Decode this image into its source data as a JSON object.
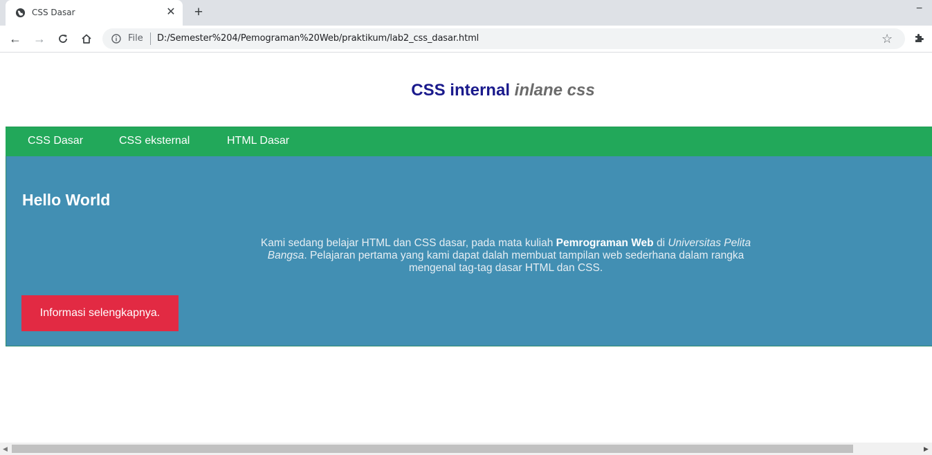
{
  "browser": {
    "tab": {
      "title": "CSS Dasar",
      "favicon": "globe-icon",
      "close_glyph": "✕"
    },
    "new_tab_glyph": "+",
    "minimize_glyph": "−",
    "toolbar": {
      "back_glyph": "←",
      "forward_glyph": "→",
      "reload_glyph": "C",
      "home_glyph": "⌂",
      "url_scheme": "File",
      "url": "D:/Semester%204/Pemograman%20Web/praktikum/lab2_css_dasar.html",
      "star_glyph": "☆"
    }
  },
  "page": {
    "title_main": "CSS internal",
    "title_italic": "inlane css",
    "nav": [
      {
        "label": "CSS Dasar"
      },
      {
        "label": "CSS eksternal"
      },
      {
        "label": "HTML Dasar"
      }
    ],
    "hero": {
      "heading": "Hello World",
      "para_part1": "Kami sedang belajar HTML dan CSS dasar, pada mata kuliah ",
      "para_bold": "Pemrograman Web",
      "para_part2": " di ",
      "para_italic": "Universitas Pelita Bangsa",
      "para_part3": ". Pelajaran pertama yang kami dapat dalah membuat tampilan web sederhana dalam rangka mengenal tag-tag dasar HTML dan CSS.",
      "button_label": "Informasi selengkapnya."
    }
  },
  "colors": {
    "navbar": "#22a85a",
    "hero": "#428fb3",
    "button": "#e22a43",
    "title": "#1a1a8c"
  }
}
